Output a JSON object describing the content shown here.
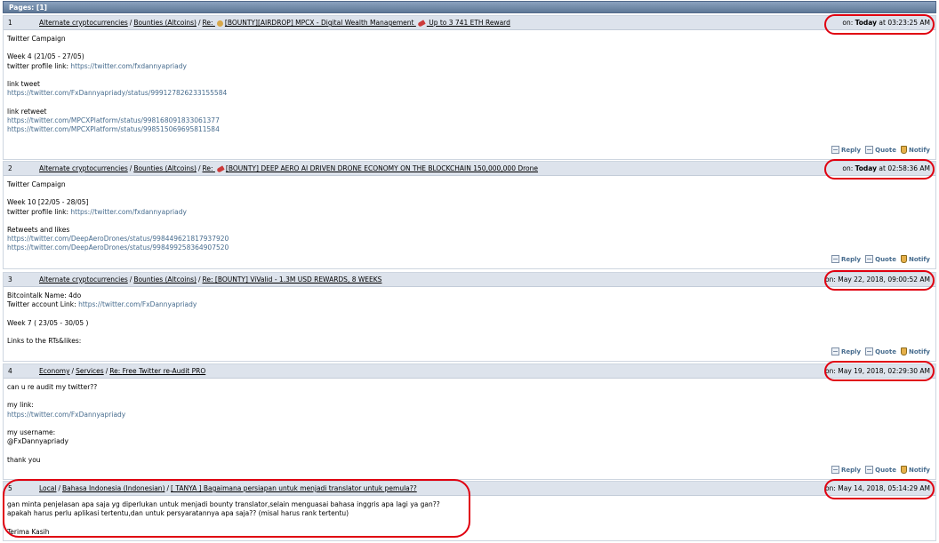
{
  "pages_label": "Pages: [1]",
  "posts": [
    {
      "num": "1",
      "crumbs": [
        "Alternate cryptocurrencies",
        "Bounties (Altcoins)"
      ],
      "title_pre": "Re: ",
      "title_main": "[BOUNTY][AIRDROP] MPCX - Digital Wealth Management ",
      "title_post": " Up to 3 741 ETH Reward",
      "title_emoji_pre": "money-bag",
      "title_emoji_post": "rocket",
      "date_prefix": "on: ",
      "date_bold": "Today",
      "date_rest": " at 03:23:25 AM",
      "body": [
        {
          "t": "Twitter Campaign"
        },
        {
          "t": ""
        },
        {
          "t": "Week 4 (21/05 - 27/05)"
        },
        {
          "t": "twitter profile link: ",
          "link": "https://twitter.com/fxdannyapriady"
        },
        {
          "t": ""
        },
        {
          "t": "link tweet"
        },
        {
          "link": "https://twitter.com/FxDannyapriady/status/999127826233155584"
        },
        {
          "t": ""
        },
        {
          "t": "link retweet"
        },
        {
          "link": "https://twitter.com/MPCXPlatform/status/998168091833061377"
        },
        {
          "link": "https://twitter.com/MPCXPlatform/status/998515069695811584"
        }
      ]
    },
    {
      "num": "2",
      "crumbs": [
        "Alternate cryptocurrencies",
        "Bounties (Altcoins)"
      ],
      "title_pre": "Re: ",
      "title_main": "[BOUNTY] DEEP AERO AI DRIVEN DRONE ECONOMY ON THE BLOCKCHAIN 150,000,000 Drone",
      "title_emoji_pre": "rocket",
      "date_prefix": "on: ",
      "date_bold": "Today",
      "date_rest": " at 02:58:36 AM",
      "body": [
        {
          "t": "Twitter Campaign"
        },
        {
          "t": ""
        },
        {
          "t": "Week 10 [22/05 - 28/05]"
        },
        {
          "t": "twitter profile link: ",
          "link": "https://twitter.com/fxdannyapriady"
        },
        {
          "t": ""
        },
        {
          "t": "Retweets and likes"
        },
        {
          "link": "https://twitter.com/DeepAeroDrones/status/998449621817937920"
        },
        {
          "link": "https://twitter.com/DeepAeroDrones/status/998499258364907520"
        }
      ]
    },
    {
      "num": "3",
      "crumbs": [
        "Alternate cryptocurrencies",
        "Bounties (Altcoins)"
      ],
      "title_pre": "Re: ",
      "title_main": "[BOUNTY] ViValid - 1.3M USD REWARDS, 8 WEEKS",
      "date_prefix": "on: ",
      "date_bold": "",
      "date_rest": "May 22, 2018, 09:00:52 AM",
      "body": [
        {
          "t": "Bitcointalk Name: 4do"
        },
        {
          "t": "Twitter account Link: ",
          "link": "https://twitter.com/FxDannyapriady"
        },
        {
          "t": ""
        },
        {
          "t": "Week 7 ( 23/05 - 30/05 )"
        },
        {
          "t": ""
        },
        {
          "t": "Links to the RTs&likes:"
        }
      ]
    },
    {
      "num": "4",
      "crumbs": [
        "Economy",
        "Services"
      ],
      "title_pre": "Re: ",
      "title_main": "Free Twitter re-Audit PRO",
      "date_prefix": "on: ",
      "date_bold": "",
      "date_rest": "May 19, 2018, 02:29:30 AM",
      "body": [
        {
          "t": "can u re audit my twitter??"
        },
        {
          "t": ""
        },
        {
          "t": "my link:"
        },
        {
          "link": "https://twitter.com/FxDannyapriady"
        },
        {
          "t": ""
        },
        {
          "t": "my username:"
        },
        {
          "t": "@FxDannyapriady"
        },
        {
          "t": ""
        },
        {
          "t": "thank you"
        }
      ]
    },
    {
      "num": "5",
      "crumbs": [
        "Local",
        "Bahasa Indonesia (Indonesian)"
      ],
      "title_pre": "",
      "title_main": "[ TANYA ] Bagaimana persiapan untuk menjadi translator untuk pemula??",
      "date_prefix": "on: ",
      "date_bold": "",
      "date_rest": "May 14, 2018, 05:14:29 AM",
      "body": [
        {
          "t": "gan minta penjelasan apa saja yg diperlukan untuk menjadi bounty translator,selain menguasai bahasa inggris apa lagi ya gan??"
        },
        {
          "t": "apakah harus perlu aplikasi tertentu,dan untuk persyaratannya apa saja?? (misal harus rank tertentu)"
        },
        {
          "t": ""
        },
        {
          "t": "Terima Kasih"
        }
      ]
    }
  ],
  "actions": {
    "reply": "Reply",
    "quote": "Quote",
    "notify": "Notify"
  },
  "annotation_color": "#e00010"
}
